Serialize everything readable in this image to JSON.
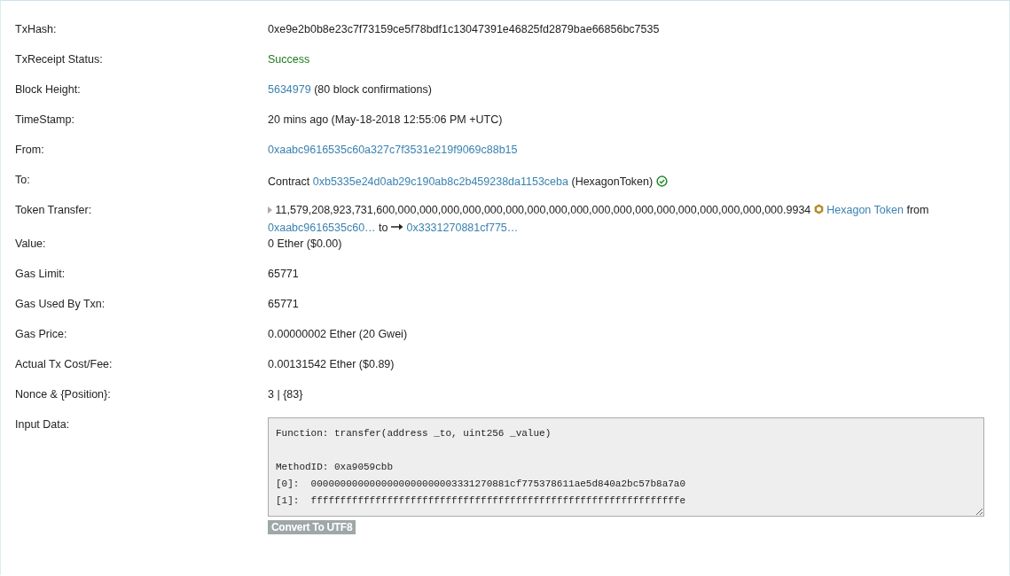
{
  "rows": [
    {
      "label": "TxHash:",
      "parts": [
        {
          "kind": "text",
          "text": "0xe9e2b0b8e23c7f73159ce5f78bdf1c13047391e46825fd2879bae66856bc7535"
        }
      ]
    },
    {
      "label": "TxReceipt Status:",
      "parts": [
        {
          "kind": "status",
          "text": "Success"
        }
      ]
    },
    {
      "label": "Block Height:",
      "parts": [
        {
          "kind": "link",
          "text": "5634979"
        },
        {
          "kind": "text",
          "text": "(80 block confirmations)"
        }
      ]
    },
    {
      "label": "TimeStamp:",
      "parts": [
        {
          "kind": "text",
          "text": "20 mins ago (May-18-2018 12:55:06 PM +UTC)"
        }
      ]
    },
    {
      "label": "From:",
      "parts": [
        {
          "kind": "link",
          "text": "0xaabc9616535c60a327c7f3531e219f9069c88b15"
        }
      ]
    },
    {
      "label": "To:",
      "parts": [
        {
          "kind": "text",
          "text": "Contract"
        },
        {
          "kind": "link",
          "text": "0xb5335e24d0ab29c190ab8c2b459238da1153ceba"
        },
        {
          "kind": "text",
          "text": "(HexagonToken)"
        },
        {
          "kind": "check"
        }
      ]
    },
    {
      "label": "Token Transfer:",
      "parts": [
        {
          "kind": "caret"
        },
        {
          "kind": "text",
          "text": "11,579,208,923,731,600,000,000,000,000,000,000,000,000,000,000,000,000,000,000,000,000,000,000.9934"
        },
        {
          "kind": "coin"
        },
        {
          "kind": "link",
          "text": "Hexagon Token"
        },
        {
          "kind": "text",
          "text": " from"
        },
        {
          "kind": "link",
          "text": "0xaabc9616535c60…"
        },
        {
          "kind": "text",
          "text": "to"
        },
        {
          "kind": "arrow"
        },
        {
          "kind": "link",
          "text": "0x3331270881cf775…"
        }
      ]
    },
    {
      "label": "Value:",
      "parts": [
        {
          "kind": "text",
          "text": "0 Ether ($0.00)"
        }
      ]
    },
    {
      "label": "Gas Limit:",
      "parts": [
        {
          "kind": "text",
          "text": "65771"
        }
      ]
    },
    {
      "label": "Gas Used By Txn:",
      "parts": [
        {
          "kind": "text",
          "text": "65771"
        }
      ]
    },
    {
      "label": "Gas Price:",
      "parts": [
        {
          "kind": "text",
          "text": "0.00000002 Ether (20 Gwei)"
        }
      ]
    },
    {
      "label": "Actual Tx Cost/Fee:",
      "parts": [
        {
          "kind": "text",
          "text": "0.00131542 Ether ($0.89)"
        }
      ]
    },
    {
      "label": "Nonce & {Position}:",
      "parts": [
        {
          "kind": "text",
          "text": "3 | {83}"
        }
      ]
    }
  ],
  "input_data": {
    "label": "Input Data:",
    "value": "Function: transfer(address _to, uint256 _value)\n\nMethodID: 0xa9059cbb\n[0]:  0000000000000000000000003331270881cf775378611ae5d840a2bc57b8a7a0\n[1]:  fffffffffffffffffffffffffffffffffffffffffffffffffffffffffffffffe",
    "button": "Convert To UTF8"
  }
}
